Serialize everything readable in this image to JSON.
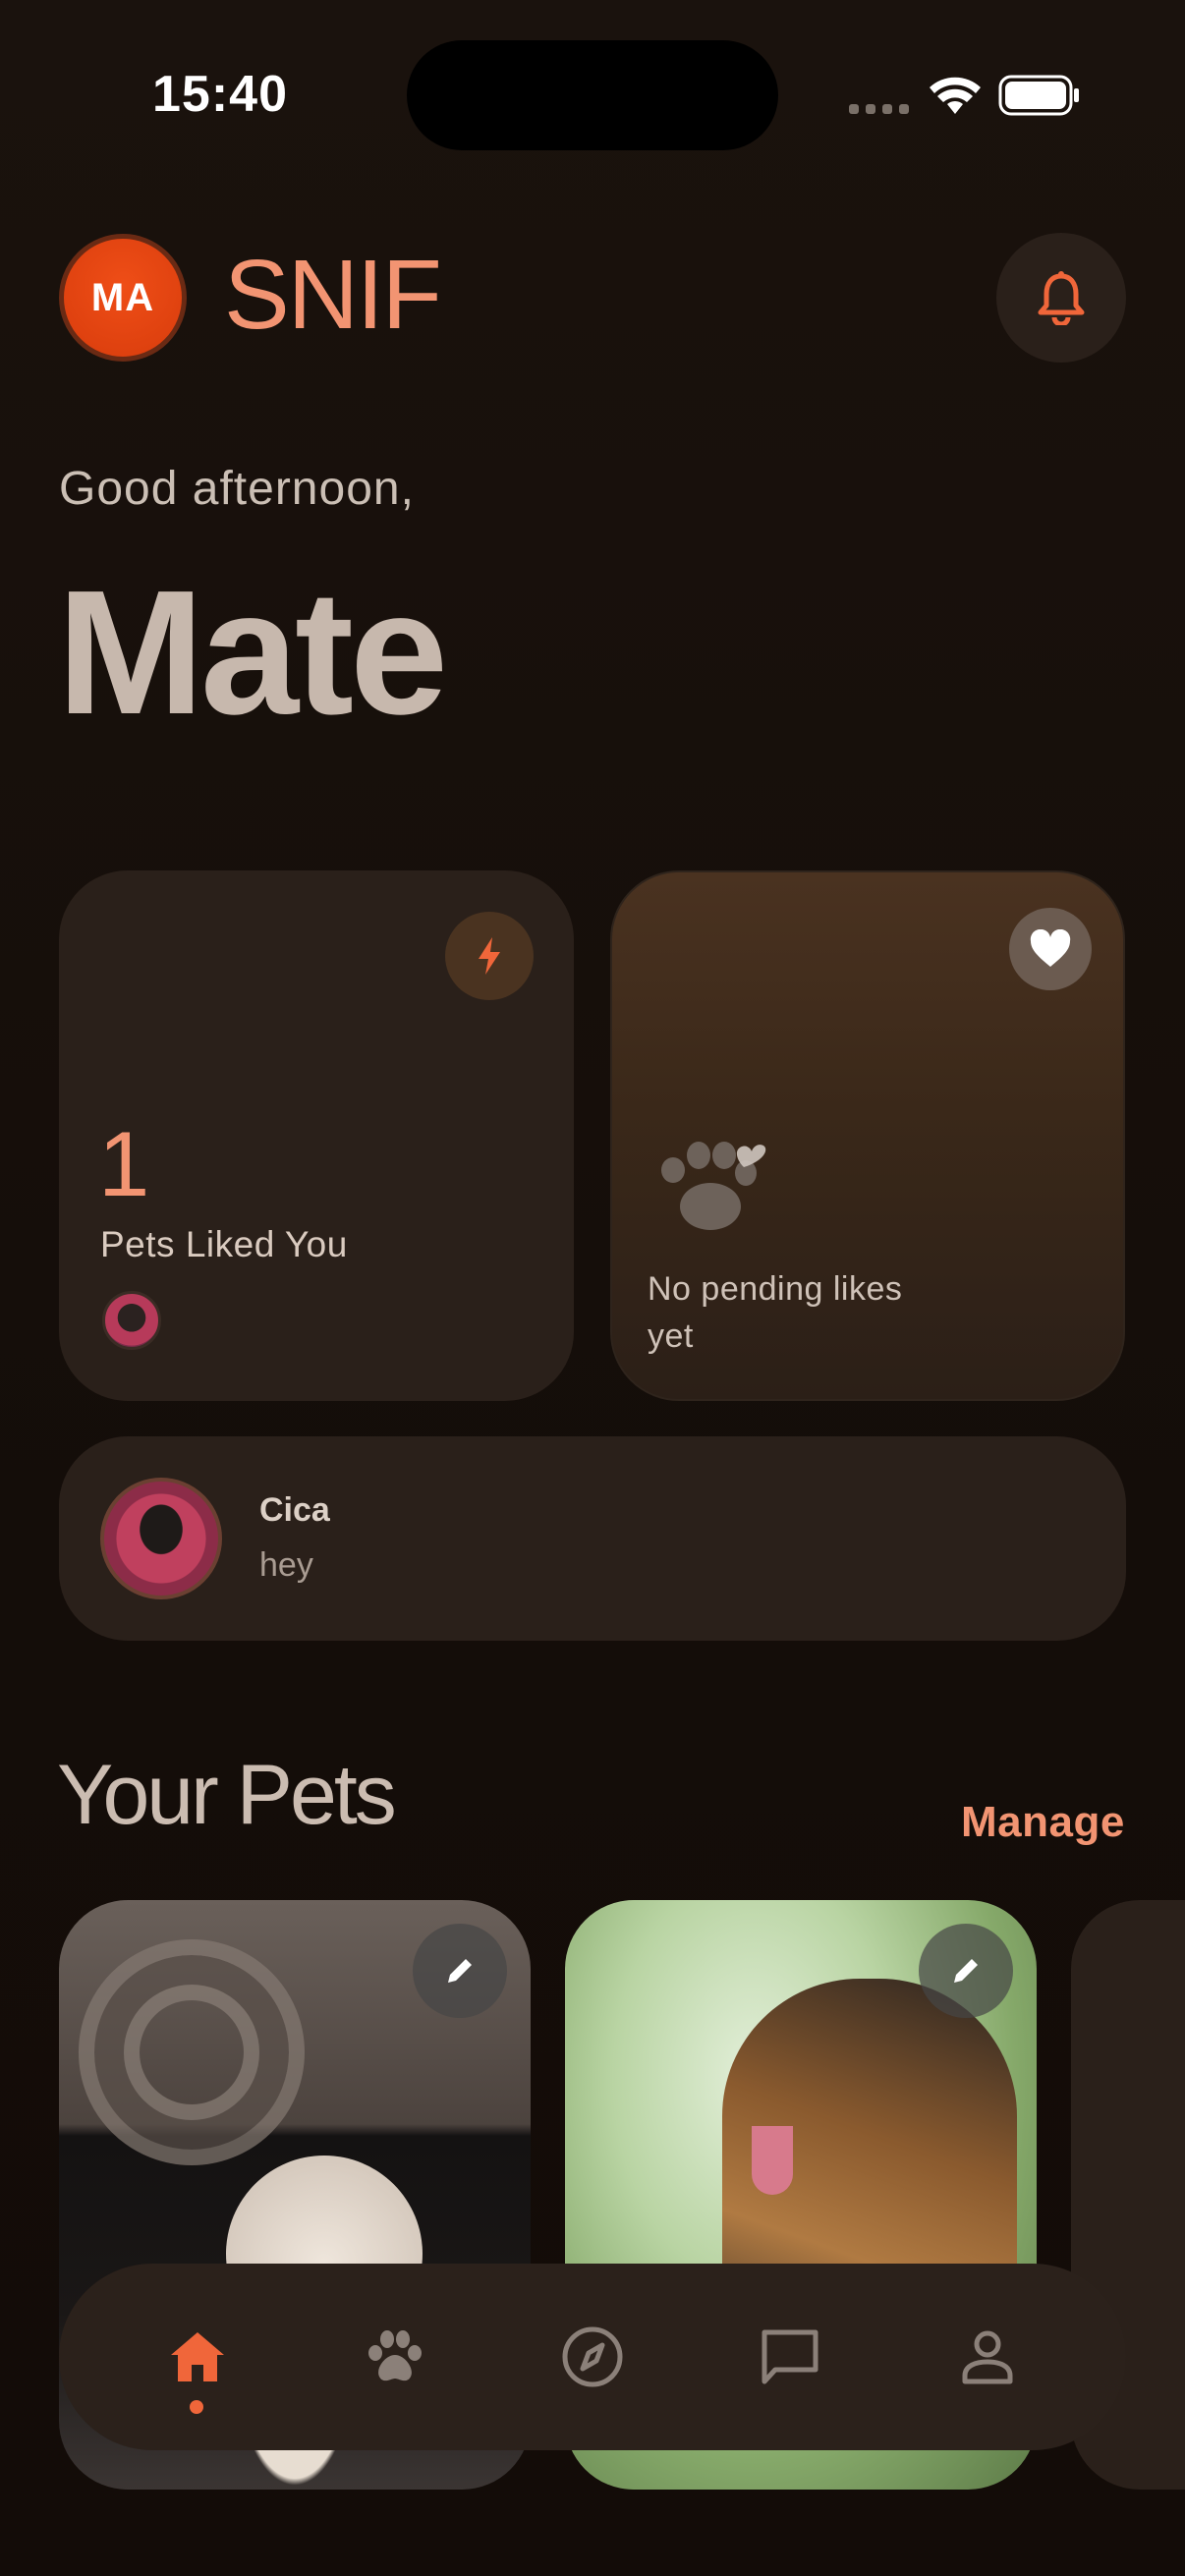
{
  "status_bar": {
    "time": "15:40"
  },
  "header": {
    "avatar_initials": "MA",
    "brand": "SNIF"
  },
  "greeting": {
    "line": "Good afternoon,",
    "name": "Mate"
  },
  "stats": {
    "liked": {
      "count": "1",
      "label": "Pets Liked You"
    },
    "pending": {
      "label": "No pending likes yet"
    }
  },
  "recent_message": {
    "name": "Cica",
    "text": "hey"
  },
  "pets_section": {
    "title": "Your Pets",
    "manage_label": "Manage"
  },
  "nav": {
    "active": "home",
    "items": [
      "home",
      "pets",
      "explore",
      "chat",
      "profile"
    ]
  },
  "colors": {
    "accent": "#f29472",
    "brand_orange": "#e8481a",
    "background": "#150e0a",
    "card": "#2a201a"
  }
}
